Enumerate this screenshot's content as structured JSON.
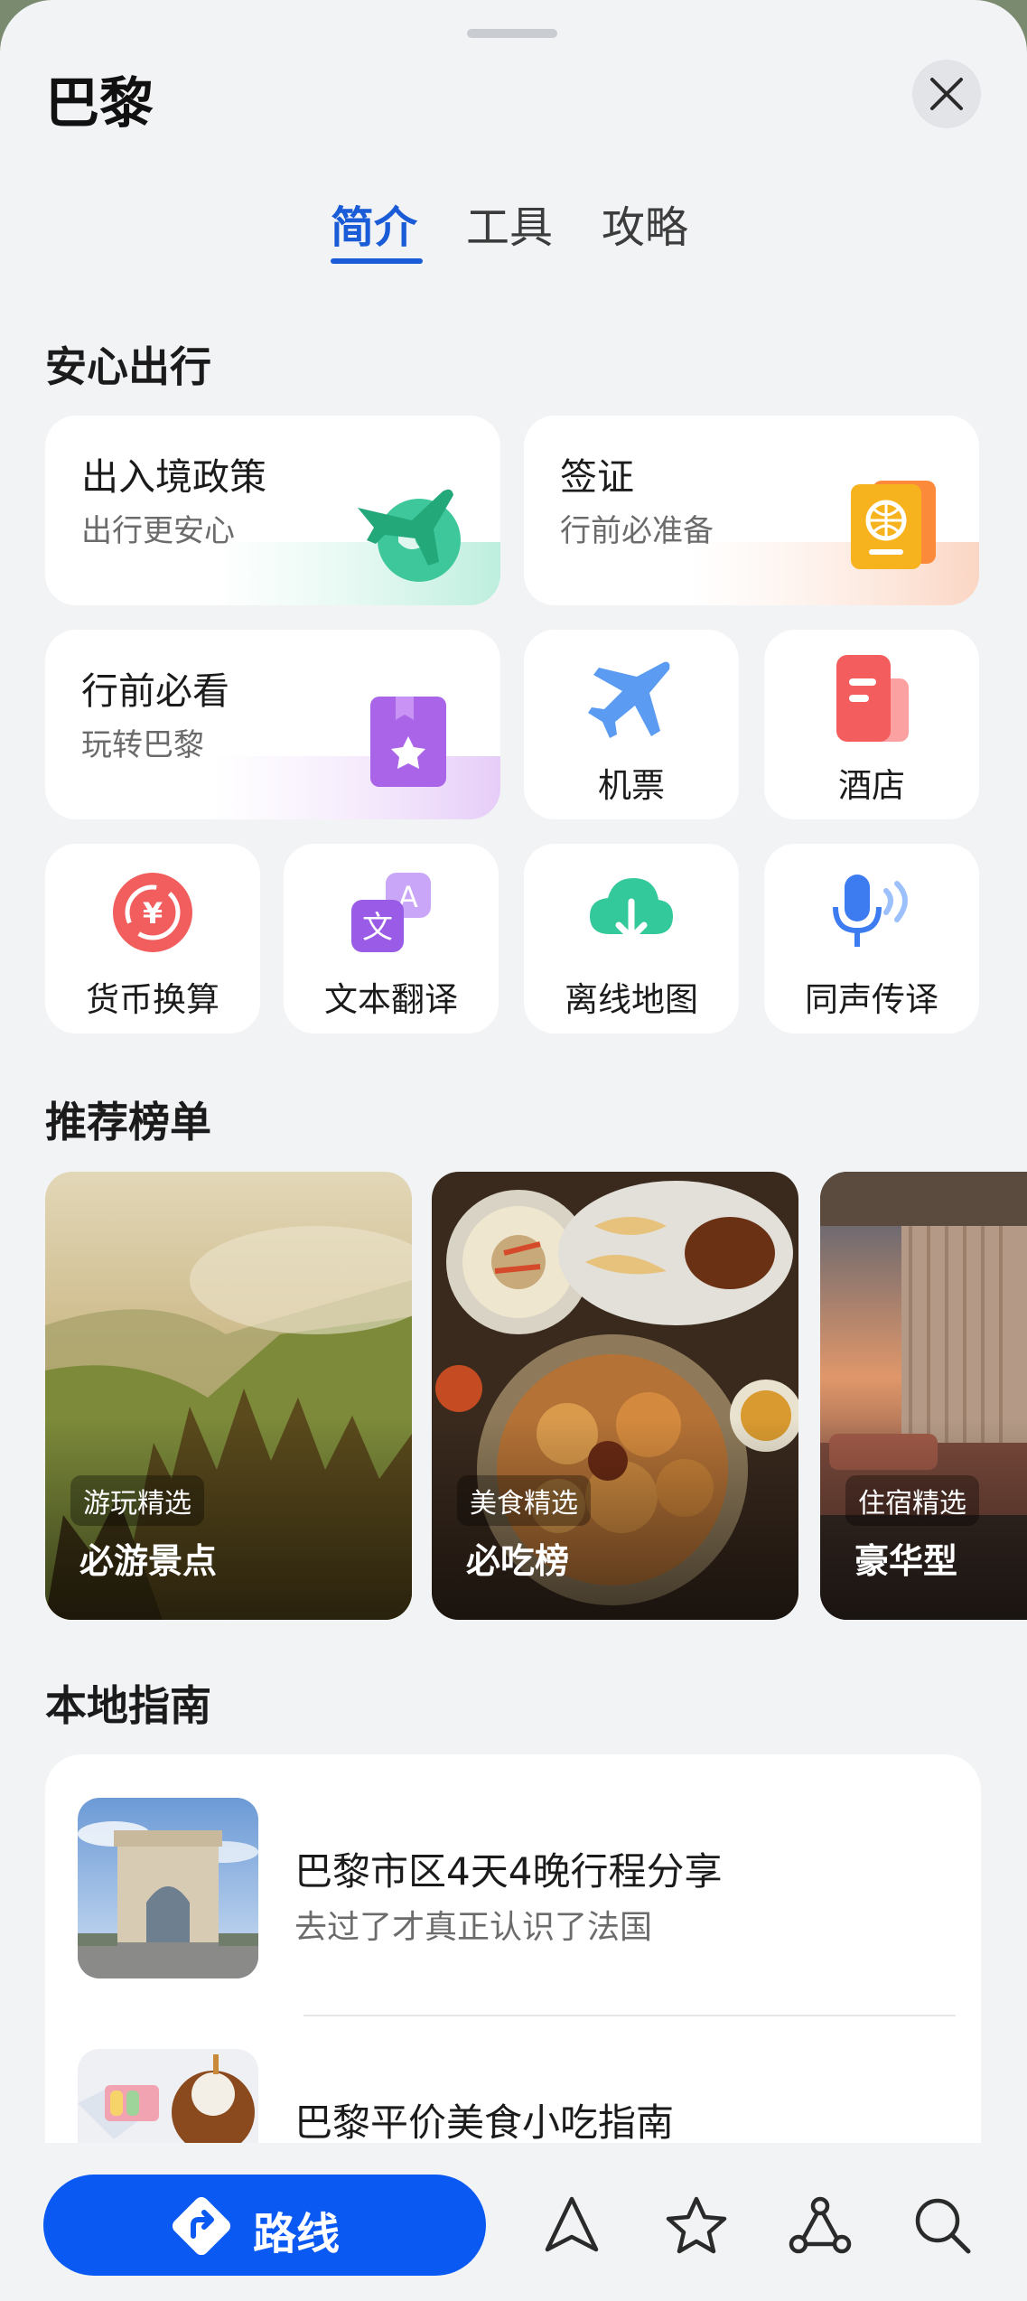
{
  "header": {
    "title": "巴黎"
  },
  "tabs": [
    {
      "label": "简介",
      "active": true
    },
    {
      "label": "工具",
      "active": false
    },
    {
      "label": "攻略",
      "active": false
    }
  ],
  "sections": {
    "safe_travel": "安心出行",
    "recommend": "推荐榜单",
    "local_guide": "本地指南"
  },
  "safe_travel": {
    "policy": {
      "title": "出入境政策",
      "subtitle": "出行更安心"
    },
    "visa": {
      "title": "签证",
      "subtitle": "行前必准备"
    },
    "pretrip": {
      "title": "行前必看",
      "subtitle": "玩转巴黎"
    },
    "flights": {
      "label": "机票"
    },
    "hotel": {
      "label": "酒店"
    }
  },
  "tools": [
    {
      "label": "货币换算",
      "icon": "currency-exchange-icon"
    },
    {
      "label": "文本翻译",
      "icon": "text-translate-icon"
    },
    {
      "label": "离线地图",
      "icon": "offline-map-icon"
    },
    {
      "label": "同声传译",
      "icon": "simultaneous-interpret-icon"
    }
  ],
  "recommendations": [
    {
      "tag": "游玩精选",
      "title": "必游景点"
    },
    {
      "tag": "美食精选",
      "title": "必吃榜"
    },
    {
      "tag": "住宿精选",
      "title": "豪华型"
    }
  ],
  "guides": [
    {
      "title": "巴黎市区4天4晚行程分享",
      "subtitle": "去过了才真正认识了法国"
    },
    {
      "title": "巴黎平价美食小吃指南"
    }
  ],
  "bottom_bar": {
    "route_label": "路线"
  },
  "colors": {
    "accent": "#1a5cd7",
    "route_button": "#0a59f2",
    "background": "#f1f3f5"
  }
}
